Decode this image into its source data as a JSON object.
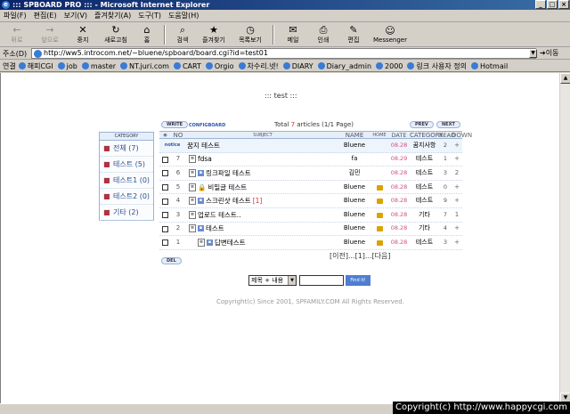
{
  "window": {
    "title": "::: SPBOARD PRO ::: - Microsoft Internet Explorer",
    "controls": [
      "_",
      "□",
      "×"
    ]
  },
  "menu": [
    "파일(F)",
    "편집(E)",
    "보기(V)",
    "즐겨찾기(A)",
    "도구(T)",
    "도움말(H)"
  ],
  "toolbar": [
    {
      "label": "뒤로",
      "icon": "←",
      "disabled": true
    },
    {
      "label": "앞으로",
      "icon": "→",
      "disabled": true
    },
    {
      "label": "중지",
      "icon": "✕"
    },
    {
      "label": "새로고침",
      "icon": "↻"
    },
    {
      "label": "홈",
      "icon": "⌂"
    },
    {
      "label": "검색",
      "icon": "⌕"
    },
    {
      "label": "즐겨찾기",
      "icon": "★"
    },
    {
      "label": "목록보기",
      "icon": "◷"
    },
    {
      "label": "메일",
      "icon": "✉"
    },
    {
      "label": "인쇄",
      "icon": "⎙"
    },
    {
      "label": "편집",
      "icon": "✎"
    },
    {
      "label": "Messenger",
      "icon": "☺"
    }
  ],
  "address": {
    "label": "주소(D)",
    "url": "http://ww5.introcom.net/~bluene/spboard/board.cgi?id=test01",
    "go": "이동"
  },
  "links": {
    "label": "연결",
    "items": [
      "해피CGI",
      "job",
      "master",
      "NT.juri.com",
      "CART",
      "Orgio",
      "차수리.넷!",
      "DIARY",
      "Diary_admin",
      "2000",
      "링크 사용자 정의",
      "Hotmail"
    ]
  },
  "board": {
    "title": "::: test :::",
    "write": "WRITE",
    "config": "CONFIGBOARD",
    "total_prefix": "Total ",
    "total_count": "7",
    "total_suffix": " articles (1/1 Page)",
    "prev": "PREV",
    "next": "NEXT",
    "category_head": "CATEGORY",
    "categories": [
      "전체 (7)",
      "테스트 (5)",
      "테스트1 (0)",
      "테스트2 (0)",
      "기타 (2)"
    ],
    "headers": [
      "",
      "NO",
      "SUBJECT",
      "NAME",
      "HOME",
      "DATE",
      "CATEGORY",
      "READ",
      "DOWN"
    ],
    "notice": {
      "badge": "notice",
      "subject": "꿈지 테스트",
      "name": "Bluene",
      "date": "08.28",
      "category": "꿈지사항",
      "read": "2",
      "down": "+"
    },
    "rows": [
      {
        "no": "7",
        "subject": "fdsa",
        "name": "fa",
        "date": "08.29",
        "category": "테스트",
        "read": "1",
        "down": "+",
        "home": false,
        "comments": ""
      },
      {
        "no": "6",
        "subject": "링크파일 테스트",
        "name": "김민",
        "date": "08.28",
        "category": "테스트",
        "read": "3",
        "down": "2",
        "home": false,
        "comments": ""
      },
      {
        "no": "5",
        "subject": "비밀글 테스트",
        "name": "Bluene",
        "date": "08.28",
        "category": "테스트",
        "read": "0",
        "down": "+",
        "home": true,
        "comments": ""
      },
      {
        "no": "4",
        "subject": "스크린샷 테스트",
        "name": "Bluene",
        "date": "08.28",
        "category": "테스트",
        "read": "9",
        "down": "+",
        "home": true,
        "comments": "[1]"
      },
      {
        "no": "3",
        "subject": "업로드 테스트..",
        "name": "Bluene",
        "date": "08.28",
        "category": "기타",
        "read": "7",
        "down": "1",
        "home": true,
        "comments": ""
      },
      {
        "no": "2",
        "subject": "테스트",
        "name": "Bluene",
        "date": "08.28",
        "category": "기타",
        "read": "4",
        "down": "+",
        "home": true,
        "comments": ""
      },
      {
        "no": "1",
        "subject": "답변테스트",
        "name": "Bluene",
        "date": "08.28",
        "category": "테스트",
        "read": "3",
        "down": "+",
        "home": true,
        "comments": ""
      }
    ],
    "del": "DEL",
    "pager": "[이전]...[1]...[다음]",
    "search_select": "제목 + 내용",
    "search_button": "Find it!",
    "copyright": "Copyright(c) Since 2001, SPFAMILY.COM All Rights Reserved."
  },
  "overlay": "Copyright(c) http://www.happycgi.com"
}
